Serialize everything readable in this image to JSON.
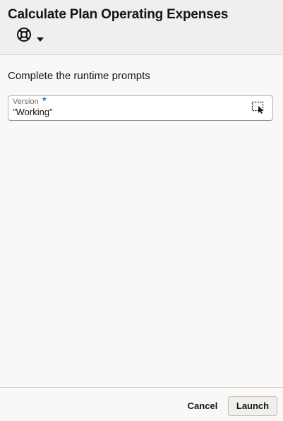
{
  "header": {
    "title": "Calculate Plan Operating Expenses",
    "help_icon": "lifebuoy-icon",
    "menu_icon": "caret-down-icon"
  },
  "prompts": {
    "heading": "Complete the runtime prompts",
    "fields": [
      {
        "label": "Version",
        "required_marker": "*",
        "value": "\"Working\"",
        "selector_icon": "member-selector-icon"
      }
    ]
  },
  "footer": {
    "cancel_label": "Cancel",
    "launch_label": "Launch"
  },
  "colors": {
    "header_bg": "#f1efed",
    "page_bg": "#f9f8f6",
    "required_star": "#2a6fae",
    "text": "#161513"
  }
}
